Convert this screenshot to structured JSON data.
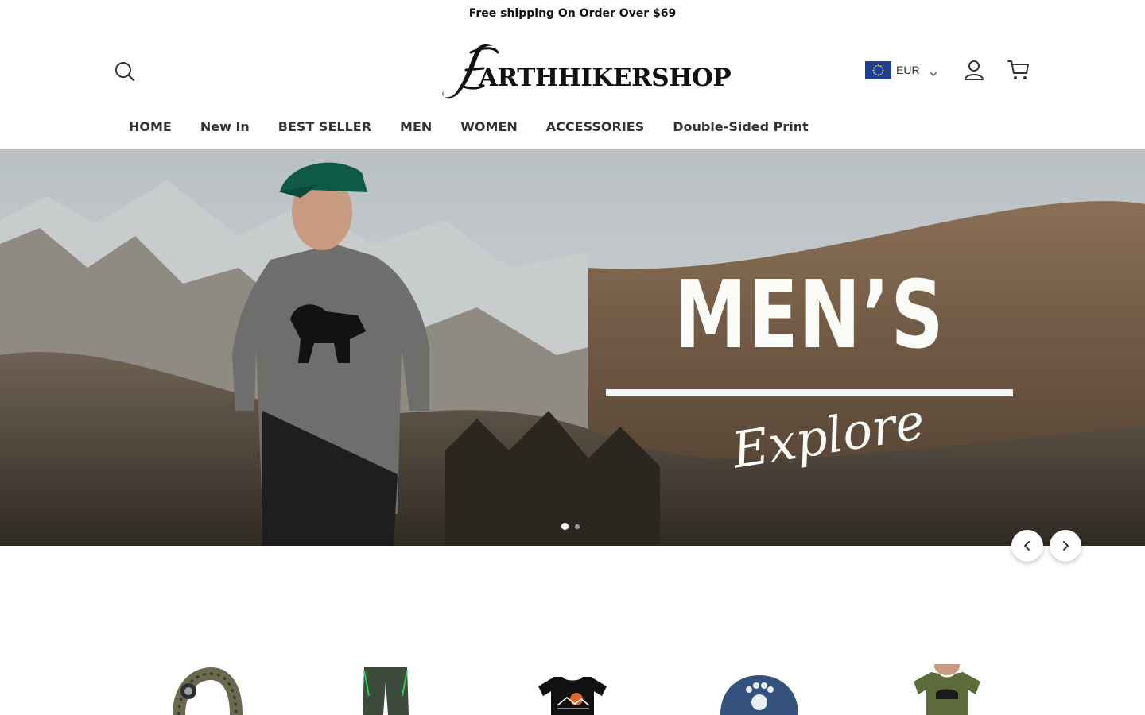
{
  "announcement": "Free shipping On Order Over $69",
  "logo": {
    "text": "ARTHHIKERSHOP",
    "mark": "E"
  },
  "currency": {
    "code": "EUR",
    "flag_color": "#1f3f95"
  },
  "icons": {
    "search": "search-icon",
    "account": "user-icon",
    "cart": "cart-icon",
    "currency_dropdown": "chevron-down-icon"
  },
  "nav": {
    "items": [
      {
        "label": "HOME"
      },
      {
        "label": "New In"
      },
      {
        "label": "BEST SELLER"
      },
      {
        "label": "MEN"
      },
      {
        "label": "WOMEN"
      },
      {
        "label": "ACCESSORIES"
      },
      {
        "label": "Double-Sided Print"
      }
    ]
  },
  "hero": {
    "title": "MEN’S",
    "subtitle": "Explore",
    "slide_count": 2,
    "active_slide": 1
  },
  "carousel": {
    "prev": "chevron-left-icon",
    "next": "chevron-right-icon"
  },
  "products": [
    {
      "name": "paracord-bracelet"
    },
    {
      "name": "hiking-pants"
    },
    {
      "name": "mountain-sunset-tshirt"
    },
    {
      "name": "bear-paw-cap"
    },
    {
      "name": "bear-tshirt"
    }
  ]
}
